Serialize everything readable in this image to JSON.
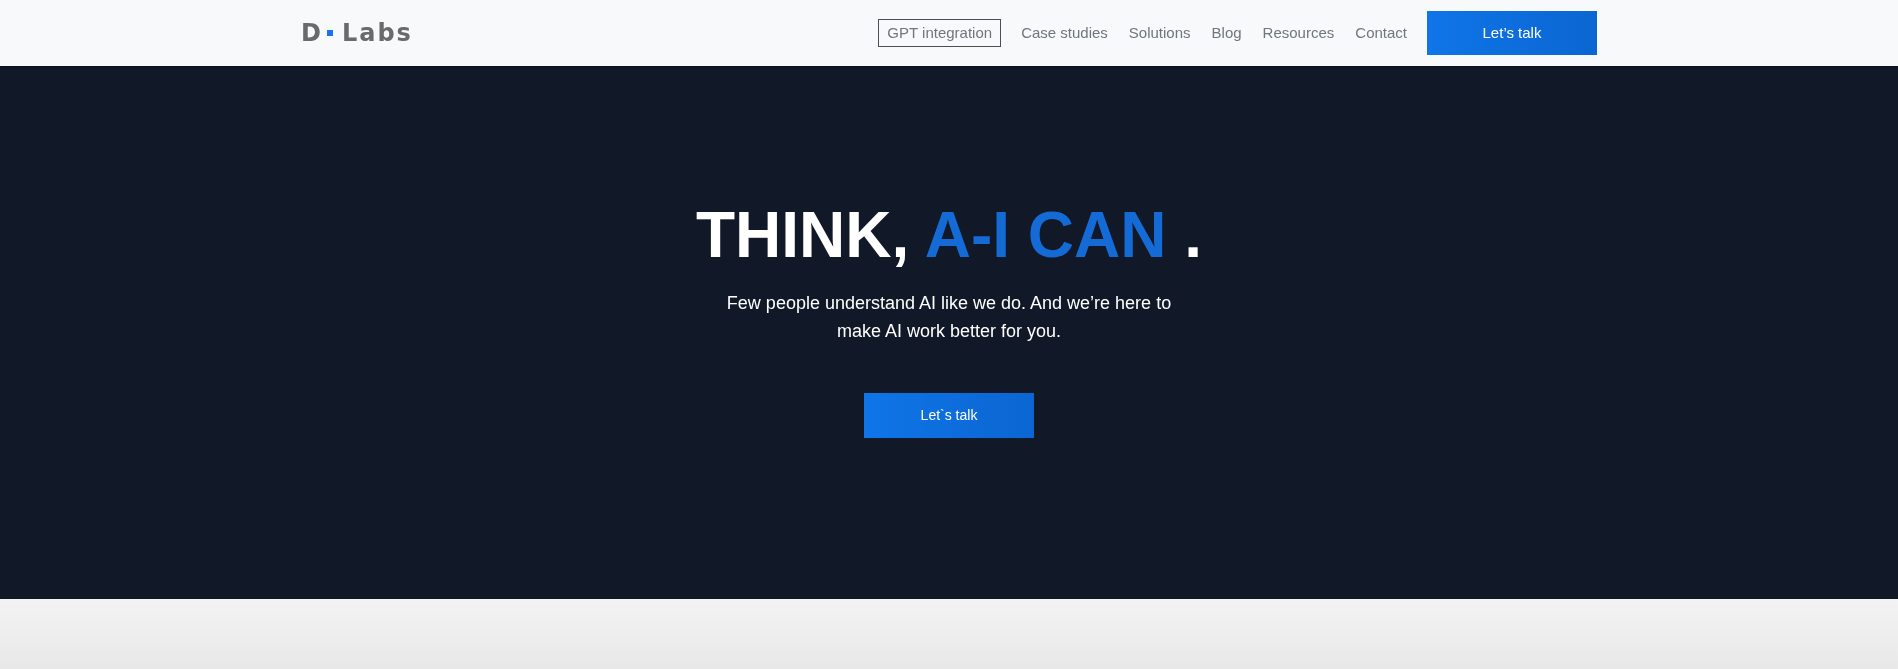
{
  "navbar": {
    "logo": {
      "letter": "D",
      "word": "Labs"
    },
    "links": [
      {
        "label": "GPT integration",
        "selected": true
      },
      {
        "label": "Case studies",
        "selected": false
      },
      {
        "label": "Solutions",
        "selected": false
      },
      {
        "label": "Blog",
        "selected": false
      },
      {
        "label": "Resources",
        "selected": false
      },
      {
        "label": "Contact",
        "selected": false
      }
    ],
    "cta": {
      "label": "Let’s talk"
    }
  },
  "hero": {
    "title": [
      {
        "text": "THINK,",
        "highlighted": false
      },
      {
        "text": "A-I CAN",
        "highlighted": true
      },
      {
        "text": ".",
        "highlighted": false
      }
    ],
    "subtitle": "Few people understand AI like we do. And we’re here to make AI work better for you.",
    "button": {
      "label": "Let`s talk"
    }
  }
}
